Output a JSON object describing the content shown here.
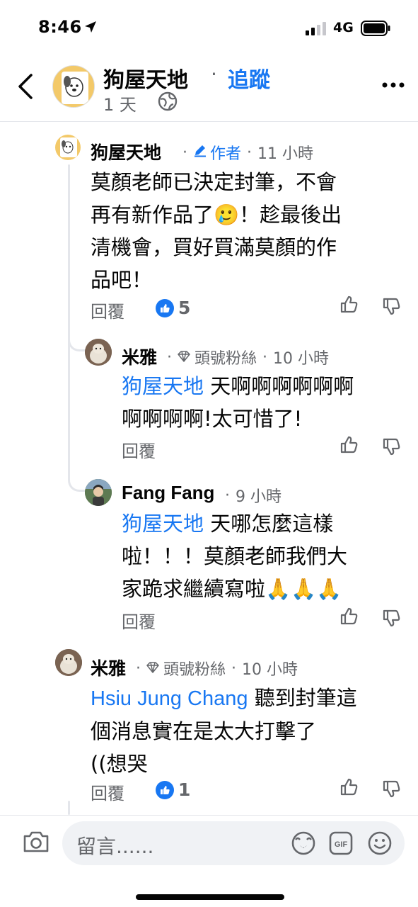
{
  "status_bar": {
    "time": "8:46",
    "network": "4G"
  },
  "header": {
    "page_name": "狗屋天地",
    "dot": "·",
    "follow_label": "追蹤",
    "time": "1 天",
    "time_dot": "·"
  },
  "comments": [
    {
      "author": "狗屋天地",
      "badge": "作者",
      "time": "11 小時",
      "lines": [
        "莫顏老師已決定封筆，不會",
        "再有新作品了🥲！趁最後出",
        "清機會，買好買滿莫顏的作",
        "品吧！"
      ],
      "reply_label": "回覆",
      "like_count": "5"
    },
    {
      "author": "米雅",
      "badge": "頭號粉絲",
      "time": "10 小時",
      "mention": "狗屋天地",
      "lines": [
        " 天啊啊啊啊啊啊",
        "啊啊啊啊!太可惜了!"
      ],
      "reply_label": "回覆"
    },
    {
      "author": "Fang Fang",
      "time": "9 小時",
      "mention": "狗屋天地",
      "lines": [
        " 天哪怎麼這樣",
        "啦！！！莫顏老師我們大",
        "家跪求繼續寫啦🙏🙏🙏"
      ],
      "reply_label": "回覆"
    },
    {
      "author": "米雅",
      "badge": "頭號粉絲",
      "time": "10 小時",
      "mention": "Hsiu Jung Chang",
      "lines": [
        " 聽到封筆這",
        "個消息實在是太大打擊了",
        "((想哭"
      ],
      "reply_label": "回覆",
      "like_count": "1"
    }
  ],
  "composer": {
    "placeholder": "留言......"
  },
  "icons": {
    "back": "chevron-left-icon",
    "more": "more-icon",
    "globe": "globe-icon",
    "like": "thumbs-up-icon",
    "dislike": "thumbs-down-icon",
    "camera": "camera-icon",
    "avatar_frame": "avatar-frame-icon",
    "gif": "gif-icon",
    "emoji": "emoji-icon"
  },
  "colors": {
    "accent": "#1877f2",
    "secondary_text": "#65676b",
    "divider": "#e4e6eb"
  }
}
